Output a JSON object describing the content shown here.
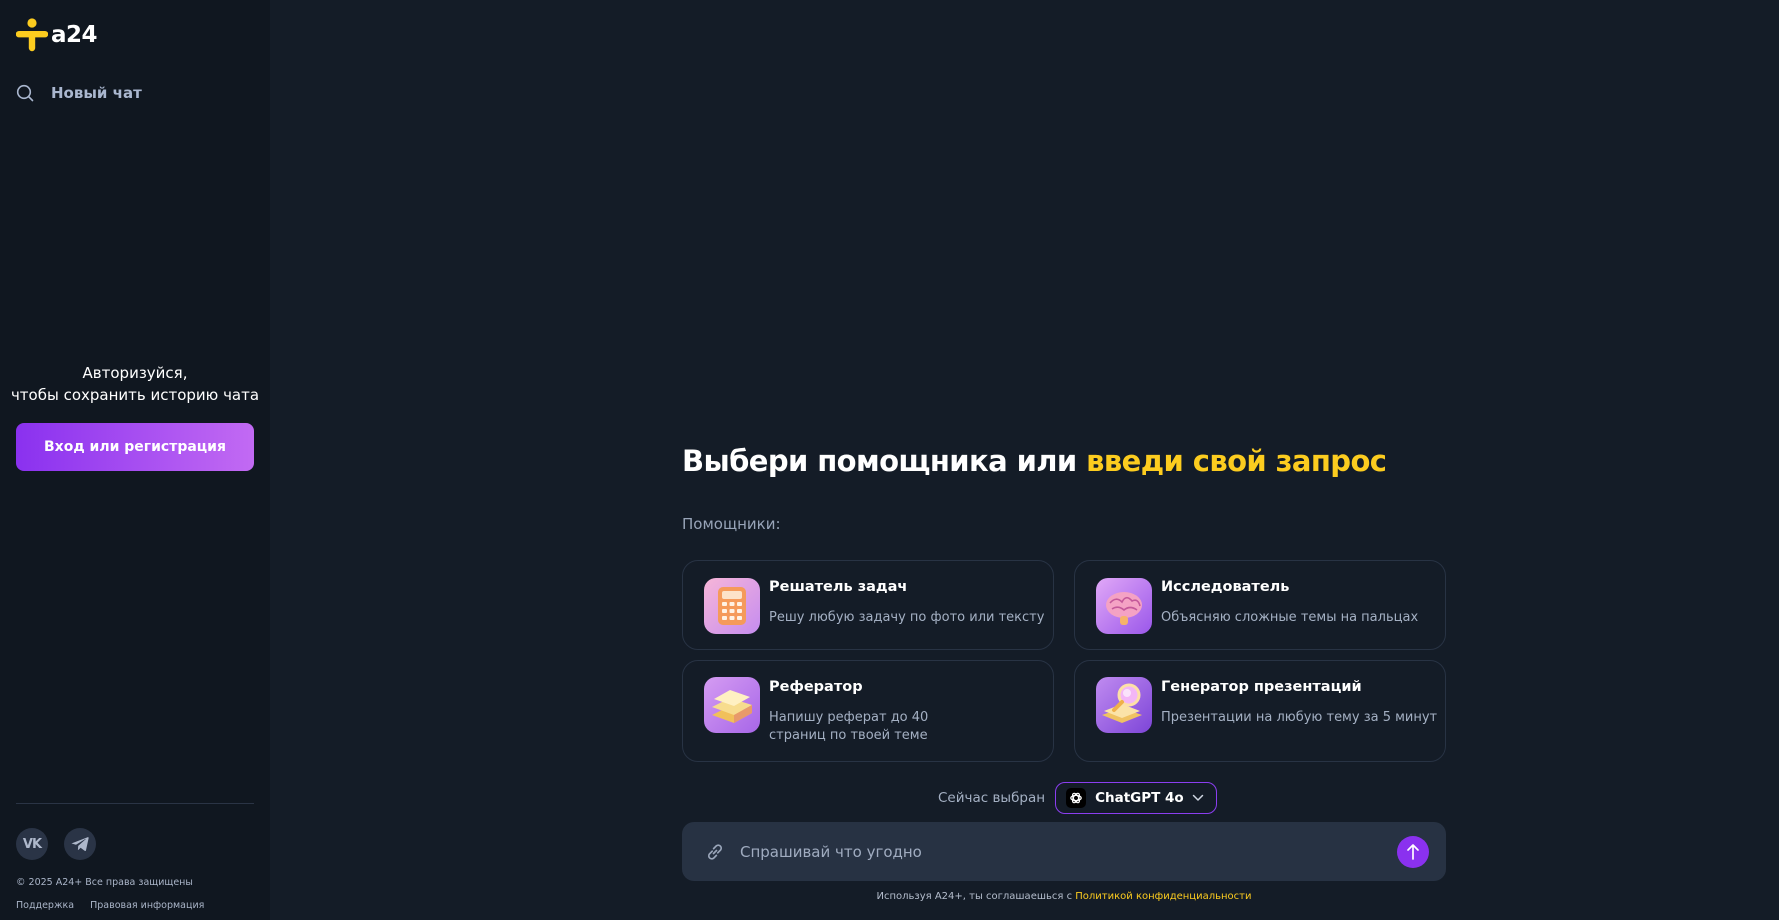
{
  "brand": {
    "logo_text": "a24"
  },
  "sidebar": {
    "new_chat_label": "Новый чат",
    "auth_line1": "Авторизуйся,",
    "auth_line2": "чтобы сохранить историю чата",
    "login_button": "Вход или регистрация",
    "social": [
      "vk-icon",
      "telegram-icon"
    ],
    "copyright": "© 2025 A24+ Все права защищены",
    "links": [
      "Поддержка",
      "Правовая информация"
    ]
  },
  "main": {
    "title_plain": "Выбери помощника или ",
    "title_accent": "введи свой запрос",
    "helpers_label": "Помощники:",
    "assistants": [
      {
        "title": "Решатель задач",
        "desc": "Решу любую задачу по фото или тексту"
      },
      {
        "title": "Исследователь",
        "desc": "Объясняю сложные темы на пальцах"
      },
      {
        "title": "Рефератор",
        "desc": "Напишу реферат до 40 страниц по твоей теме"
      },
      {
        "title": "Генератор презентаций",
        "desc": "Презентации на любую тему за 5 минут"
      }
    ],
    "model_label": "Сейчас выбран",
    "model_name": "ChatGPT 4o",
    "input_placeholder": "Спрашивай что угодно",
    "disclaimer_prefix": "Используя A24+, ты соглашаешься с ",
    "disclaimer_link": "Политикой конфиденциальности"
  },
  "colors": {
    "background": "#141c27",
    "sidebar": "#101720",
    "accent_yellow": "#fccc1f",
    "accent_purple": "#8a31ef"
  }
}
